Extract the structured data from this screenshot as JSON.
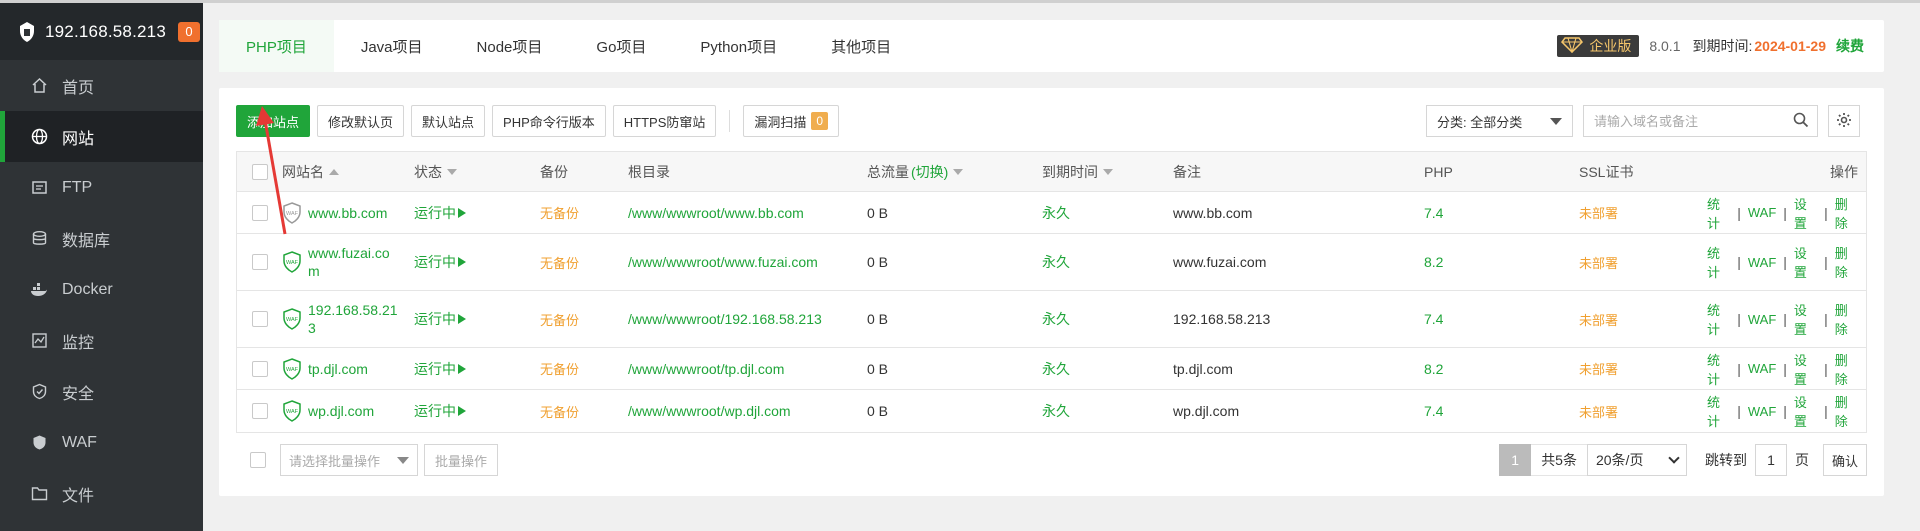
{
  "server": {
    "ip": "192.168.58.213",
    "badge": "0"
  },
  "sidebar": {
    "items": [
      {
        "label": "首页",
        "icon": "home-icon"
      },
      {
        "label": "网站",
        "icon": "globe-icon",
        "active": true
      },
      {
        "label": "FTP",
        "icon": "ftp-icon"
      },
      {
        "label": "数据库",
        "icon": "database-icon"
      },
      {
        "label": "Docker",
        "icon": "docker-icon"
      },
      {
        "label": "监控",
        "icon": "monitor-icon"
      },
      {
        "label": "安全",
        "icon": "shield-icon"
      },
      {
        "label": "WAF",
        "icon": "waf-icon"
      },
      {
        "label": "文件",
        "icon": "folder-icon"
      }
    ]
  },
  "tabs": [
    {
      "label": "PHP项目",
      "active": true
    },
    {
      "label": "Java项目"
    },
    {
      "label": "Node项目"
    },
    {
      "label": "Go项目"
    },
    {
      "label": "Python项目"
    },
    {
      "label": "其他项目"
    }
  ],
  "license": {
    "edition": "企业版",
    "version": "8.0.1",
    "expire_label": "到期时间:",
    "expire_date": "2024-01-29",
    "renew": "续费"
  },
  "toolbar": {
    "add_site": "添加站点",
    "modify_default_page": "修改默认页",
    "default_site": "默认站点",
    "php_cli_version": "PHP命令行版本",
    "https_protect": "HTTPS防窜站",
    "vuln_scan": "漏洞扫描",
    "vuln_count": "0"
  },
  "filter": {
    "category": "分类: 全部分类",
    "search_placeholder": "请输入域名或备注"
  },
  "table": {
    "headers": {
      "name": "网站名",
      "status": "状态",
      "backup": "备份",
      "root": "根目录",
      "traffic": "总流量",
      "traffic_switch": "(切换)",
      "expire": "到期时间",
      "remark": "备注",
      "php": "PHP",
      "ssl": "SSL证书",
      "ops": "操作"
    },
    "rows": [
      {
        "name": "www.bb.com",
        "status": "运行中",
        "backup": "无备份",
        "root": "/www/wwwroot/www.bb.com",
        "traffic": "0 B",
        "expire": "永久",
        "remark": "www.bb.com",
        "php": "7.4",
        "ssl": "未部署"
      },
      {
        "name": "www.fuzai.com",
        "status": "运行中",
        "backup": "无备份",
        "root": "/www/wwwroot/www.fuzai.com",
        "traffic": "0 B",
        "expire": "永久",
        "remark": "www.fuzai.com",
        "php": "8.2",
        "ssl": "未部署"
      },
      {
        "name": "192.168.58.213",
        "status": "运行中",
        "backup": "无备份",
        "root": "/www/wwwroot/192.168.58.213",
        "traffic": "0 B",
        "expire": "永久",
        "remark": "192.168.58.213",
        "php": "7.4",
        "ssl": "未部署"
      },
      {
        "name": "tp.djl.com",
        "status": "运行中",
        "backup": "无备份",
        "root": "/www/wwwroot/tp.djl.com",
        "traffic": "0 B",
        "expire": "永久",
        "remark": "tp.djl.com",
        "php": "8.2",
        "ssl": "未部署"
      },
      {
        "name": "wp.djl.com",
        "status": "运行中",
        "backup": "无备份",
        "root": "/www/wwwroot/wp.djl.com",
        "traffic": "0 B",
        "expire": "永久",
        "remark": "wp.djl.com",
        "php": "7.4",
        "ssl": "未部署"
      }
    ],
    "ops": {
      "stats": "统计",
      "waf": "WAF",
      "settings": "设置",
      "delete": "删除",
      "sep": "|"
    }
  },
  "footer": {
    "batch_select": "请选择批量操作",
    "batch_button": "批量操作",
    "current_page": "1",
    "total": "共5条",
    "page_size": "20条/页",
    "jump_label": "跳转到",
    "jump_value": "1",
    "page_unit": "页",
    "confirm": "确认"
  },
  "colors": {
    "accent": "#20a53a",
    "warning": "#f0a030",
    "expire": "#f0702e",
    "sidebar": "#2f3336"
  }
}
